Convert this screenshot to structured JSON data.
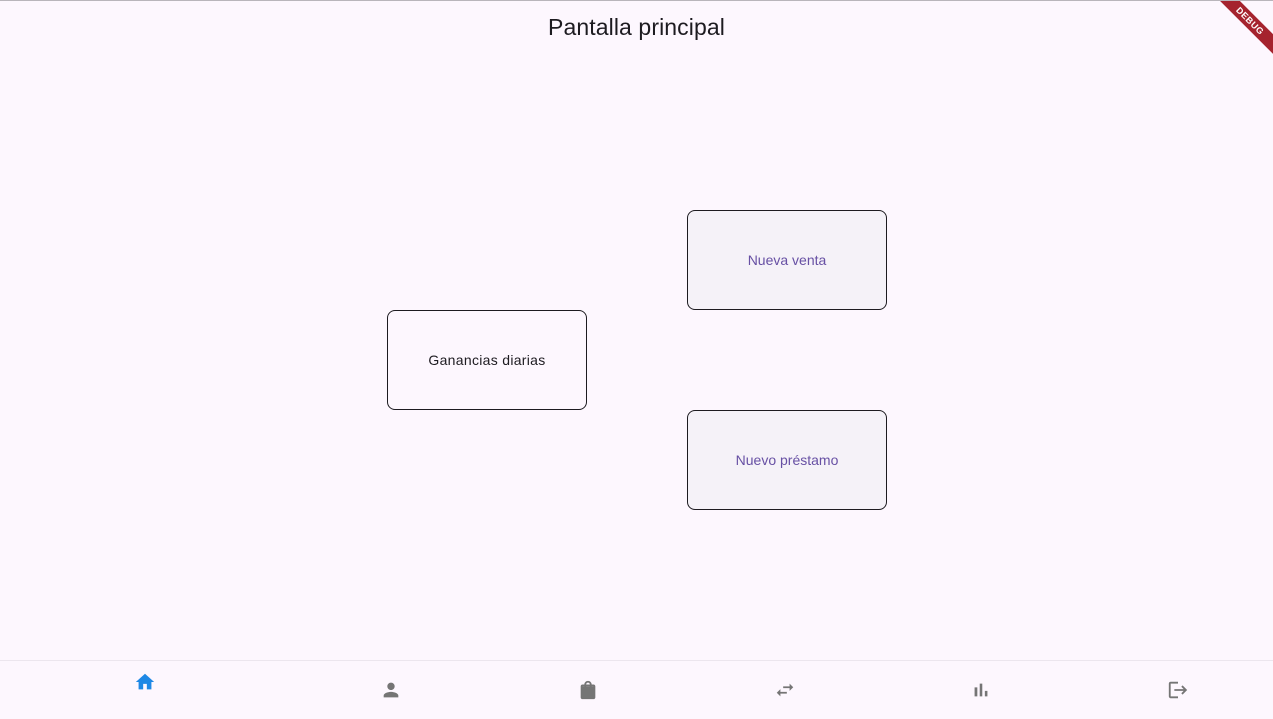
{
  "header": {
    "title": "Pantalla principal"
  },
  "debug_banner": {
    "label": "DEBUG"
  },
  "cards": {
    "daily_earnings": "Ganancias diarias",
    "new_sale": "Nueva venta",
    "new_loan": "Nuevo préstamo"
  },
  "bottom_nav": {
    "active_index": 0,
    "active_color": "#1e88e5",
    "inactive_color": "#757575",
    "items": [
      {
        "icon": "home-icon"
      },
      {
        "icon": "person-icon"
      },
      {
        "icon": "shopping-bag-icon"
      },
      {
        "icon": "swap-horiz-icon"
      },
      {
        "icon": "bar-chart-icon"
      },
      {
        "icon": "logout-icon"
      }
    ]
  }
}
